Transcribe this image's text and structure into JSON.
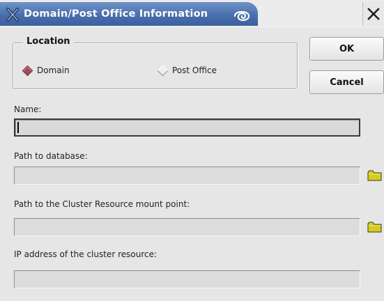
{
  "window": {
    "title": "Domain/Post Office Information",
    "icons": {
      "app": "x-logo-icon",
      "decoration": "spiral-icon",
      "close": "close-icon"
    }
  },
  "location_group": {
    "title": "Location",
    "options": [
      {
        "label": "Domain",
        "selected": true
      },
      {
        "label": "Post Office",
        "selected": false
      }
    ]
  },
  "buttons": {
    "ok": "OK",
    "cancel": "Cancel"
  },
  "fields": {
    "name": {
      "label": "Name:",
      "value": ""
    },
    "database_path": {
      "label": "Path to database:",
      "value": "",
      "browse_icon": "folder-icon"
    },
    "cluster_mount_point": {
      "label": "Path to the Cluster Resource mount point:",
      "value": "",
      "browse_icon": "folder-icon"
    },
    "cluster_ip": {
      "label": "IP address of the cluster resource:",
      "value": ""
    }
  },
  "colors": {
    "titlebar": "#4a6fae",
    "title_text": "#ffffff",
    "dialog_bg": "#e6e6e6",
    "radio_selected": "#a24a5b",
    "folder": "#d6cc1e"
  }
}
